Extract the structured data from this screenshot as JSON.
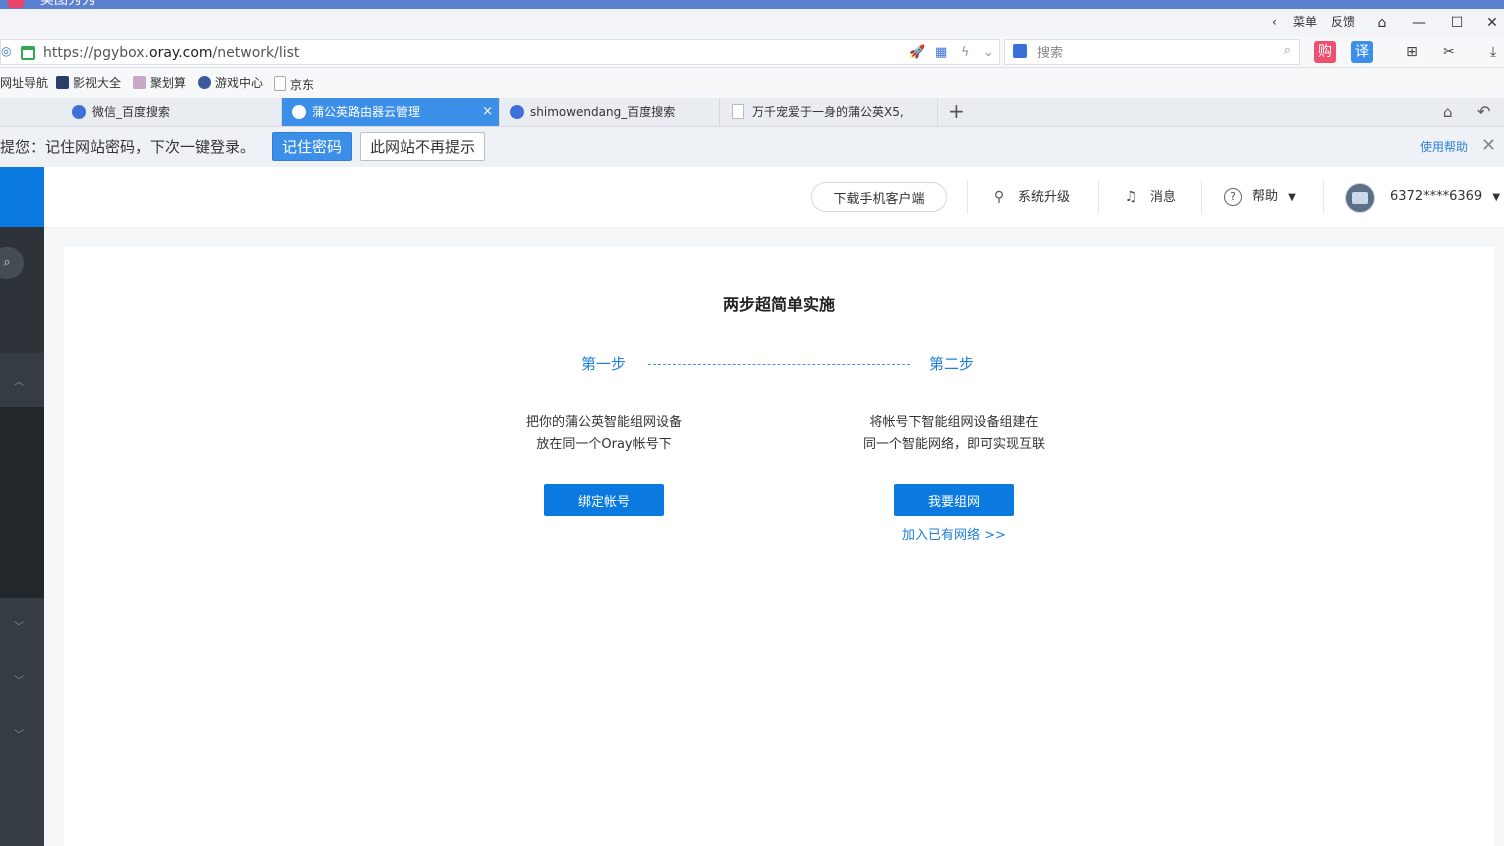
{
  "window": {
    "app_title": "美图秀秀",
    "menu_label": "菜单",
    "feedback_label": "反馈"
  },
  "addressbar": {
    "url_prefix": "https://pgybox.",
    "url_domain": "oray.com",
    "url_path": "/network/list",
    "search_placeholder": "搜索",
    "shop_label": "购",
    "translate_label": "译"
  },
  "bookmarks": [
    {
      "label": "网址导航"
    },
    {
      "label": "影视大全"
    },
    {
      "label": "聚划算"
    },
    {
      "label": "游戏中心"
    },
    {
      "label": "京东"
    }
  ],
  "tabs": [
    {
      "label": "微信_百度搜索"
    },
    {
      "label": "蒲公英路由器云管理",
      "active": true,
      "close": "×"
    },
    {
      "label": "shimowendang_百度搜索"
    },
    {
      "label": "万千宠爱于一身的蒲公英X5,"
    }
  ],
  "new_tab_label": "+",
  "password_bar": {
    "message": "提您：记住网站密码，下次一键登录。",
    "remember_label": "记住密码",
    "never_label": "此网站不再提示",
    "help_label": "使用帮助",
    "close_label": "✕"
  },
  "header": {
    "download_label": "下载手机客户端",
    "upgrade_label": "系统升级",
    "messages_label": "消息",
    "help_label": "帮助",
    "account_label": "6372****6369"
  },
  "main": {
    "title": "两步超简单实施",
    "step1_label": "第一步",
    "step2_label": "第二步",
    "step1_desc_line1": "把你的蒲公英智能组网设备",
    "step1_desc_line2": "放在同一个Oray帐号下",
    "step2_desc_line1": "将帐号下智能组网设备组建在",
    "step2_desc_line2": "同一个智能网络，即可实现互联",
    "bind_label": "绑定帐号",
    "create_label": "我要组网",
    "join_label": "加入已有网络 >>"
  },
  "colors": {
    "accent": "#0b7ae0",
    "tab_active": "#3b8fe8",
    "sidebar": "#2d3339",
    "link": "#1f7ed8"
  },
  "icons": {
    "upgrade": "rocket-icon",
    "messages": "bell-icon",
    "help": "question-icon"
  }
}
